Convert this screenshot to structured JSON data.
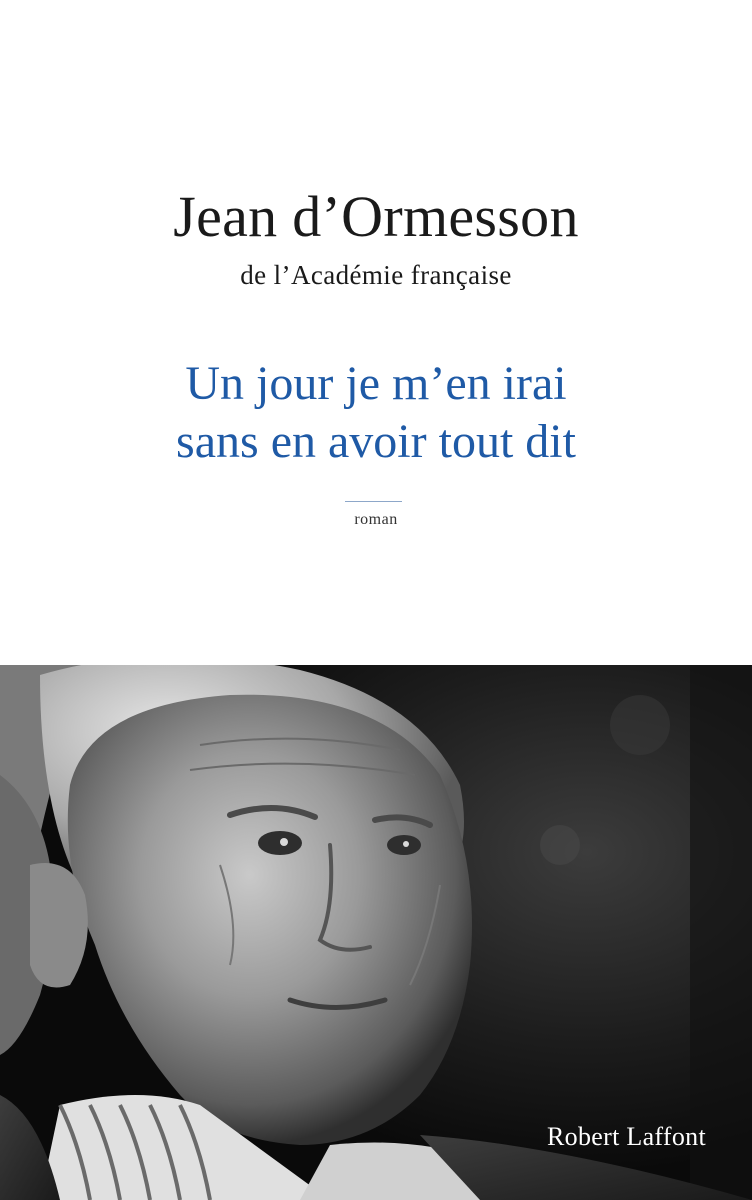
{
  "cover": {
    "author": "Jean d’Ormesson",
    "affiliation": "de l’Académie française",
    "title_lines": [
      "Un jour je m’en irai",
      "sans en avoir tout dit"
    ],
    "genre": "roman",
    "publisher": "Robert Laffont"
  },
  "photo": {
    "subject": "portrait-photo"
  },
  "colors": {
    "title": "#1f5aa6",
    "text": "#1a1a1a",
    "background": "#ffffff",
    "rule": "#8da7c9"
  }
}
